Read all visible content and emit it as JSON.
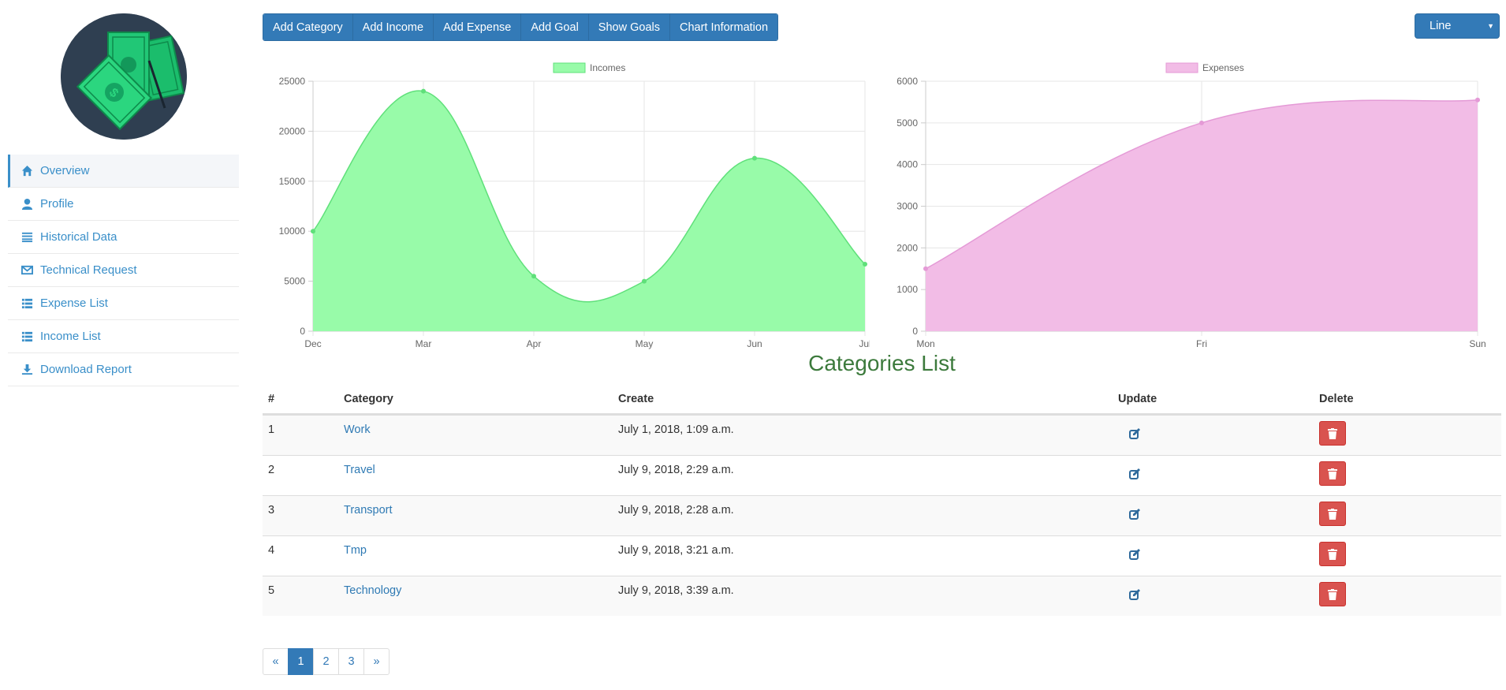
{
  "sidebar": {
    "items": [
      {
        "label": "Overview",
        "icon": "home-icon",
        "active": true
      },
      {
        "label": "Profile",
        "icon": "user-icon"
      },
      {
        "label": "Historical Data",
        "icon": "list-lines-icon"
      },
      {
        "label": "Technical Request",
        "icon": "envelope-icon"
      },
      {
        "label": "Expense List",
        "icon": "list-icon"
      },
      {
        "label": "Income List",
        "icon": "list-icon"
      },
      {
        "label": "Download Report",
        "icon": "download-icon"
      }
    ]
  },
  "toolbar": {
    "buttons": [
      "Add Category",
      "Add Income",
      "Add Expense",
      "Add Goal",
      "Show Goals",
      "Chart Information"
    ]
  },
  "chart_select": {
    "value": "Line"
  },
  "colors": {
    "primary": "#337ab7",
    "income": "#98fba9",
    "income_line": "#5fe07a",
    "expense": "#f2bce6",
    "expense_line": "#e49ad6",
    "danger": "#d9534f",
    "title": "#3c7a3c"
  },
  "chart_data": [
    {
      "type": "area",
      "legend": "Incomes",
      "x": [
        "Dec",
        "Mar",
        "Apr",
        "May",
        "Jun",
        "Jul"
      ],
      "values": [
        10000,
        24000,
        5500,
        5000,
        17300,
        6700
      ],
      "ylim": [
        0,
        25000
      ],
      "yticks": [
        0,
        5000,
        10000,
        15000,
        20000,
        25000
      ],
      "grid": true,
      "legend_position": "top"
    },
    {
      "type": "area",
      "legend": "Expenses",
      "x": [
        "Mon",
        "Fri",
        "Sun"
      ],
      "values": [
        1500,
        5000,
        5550
      ],
      "ylim": [
        0,
        6000
      ],
      "yticks": [
        0,
        1000,
        2000,
        3000,
        4000,
        5000,
        6000
      ],
      "grid": true,
      "legend_position": "top"
    }
  ],
  "categories": {
    "title": "Categories List",
    "headers": {
      "num": "#",
      "category": "Category",
      "create": "Create",
      "update": "Update",
      "delete": "Delete"
    },
    "rows": [
      {
        "num": "1",
        "category": "Work",
        "create": "July 1, 2018, 1:09 a.m."
      },
      {
        "num": "2",
        "category": "Travel",
        "create": "July 9, 2018, 2:29 a.m."
      },
      {
        "num": "3",
        "category": "Transport",
        "create": "July 9, 2018, 2:28 a.m."
      },
      {
        "num": "4",
        "category": "Tmp",
        "create": "July 9, 2018, 3:21 a.m."
      },
      {
        "num": "5",
        "category": "Technology",
        "create": "July 9, 2018, 3:39 a.m."
      }
    ]
  },
  "pagination": {
    "prev": "«",
    "pages": [
      "1",
      "2",
      "3"
    ],
    "next": "»",
    "current": "1"
  }
}
